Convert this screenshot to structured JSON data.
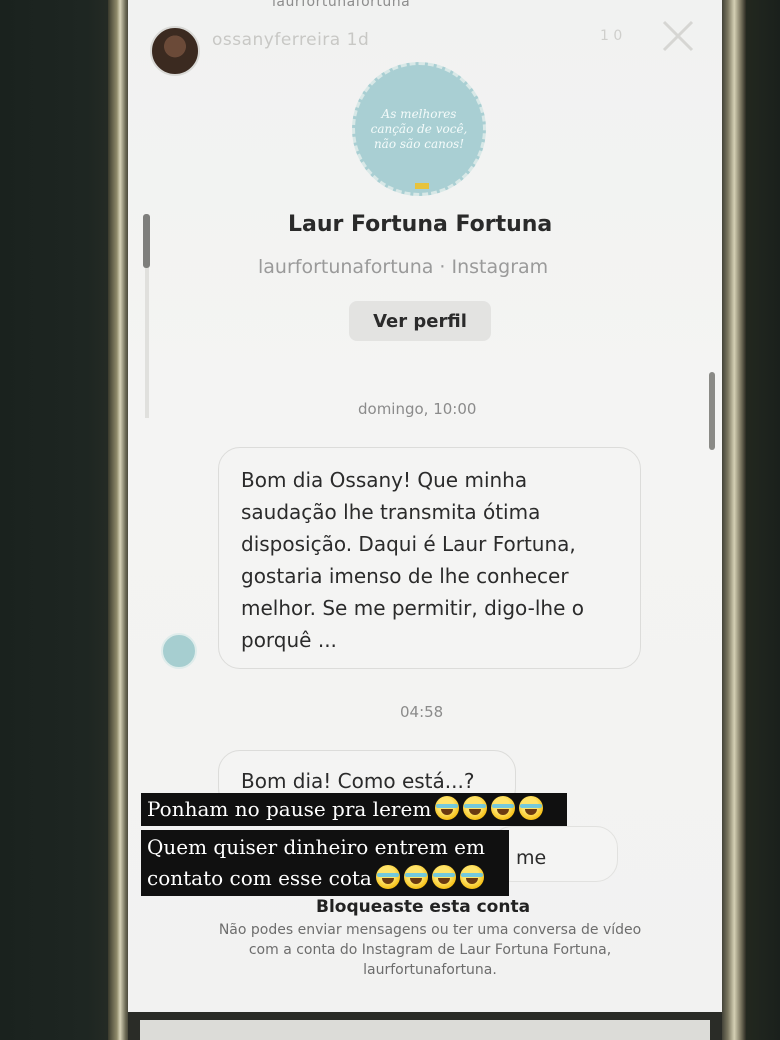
{
  "story": {
    "top_url": "laurfortunafortuna",
    "username": "ossanyferreira",
    "username_suffix": "1d",
    "time": "1 0"
  },
  "profile": {
    "picture_text": "As melhores canção de você, não são canos!",
    "name": "Laur Fortuna Fortuna",
    "handle": "laurfortunafortuna · Instagram",
    "view_profile_label": "Ver perfil"
  },
  "messages": [
    {
      "timestamp": "domingo, 10:00",
      "text_lines": [
        "Bom dia Ossany! Que minha",
        "saudação lhe transmita ótima",
        "disposição. Daqui é Laur Fortuna,",
        "gostaria imenso de lhe conhecer",
        "melhor. Se me permitir, digo-lhe o",
        "porquê ..."
      ]
    },
    {
      "timestamp": "04:58",
      "text": "Bom dia! Como está...?"
    }
  ],
  "partial_reply": "me",
  "captions": [
    {
      "text": "Ponham no pause pra lerem",
      "emoji_count": 4
    },
    {
      "line1": "Quem quiser dinheiro entrem em",
      "line2": "contato com esse cota",
      "emoji_count": 4
    }
  ],
  "blocked": {
    "title": "Bloqueaste esta conta",
    "description_lines": [
      "Não podes enviar mensagens ou ter uma conversa de vídeo",
      "com a conta do Instagram de Laur Fortuna Fortuna,",
      "laurfortunafortuna."
    ]
  },
  "colors": {
    "background": "#f3f3f2",
    "caption_bg": "#101010",
    "profile_pic": "#a9cfd3",
    "button_bg": "#e3e3e1"
  }
}
